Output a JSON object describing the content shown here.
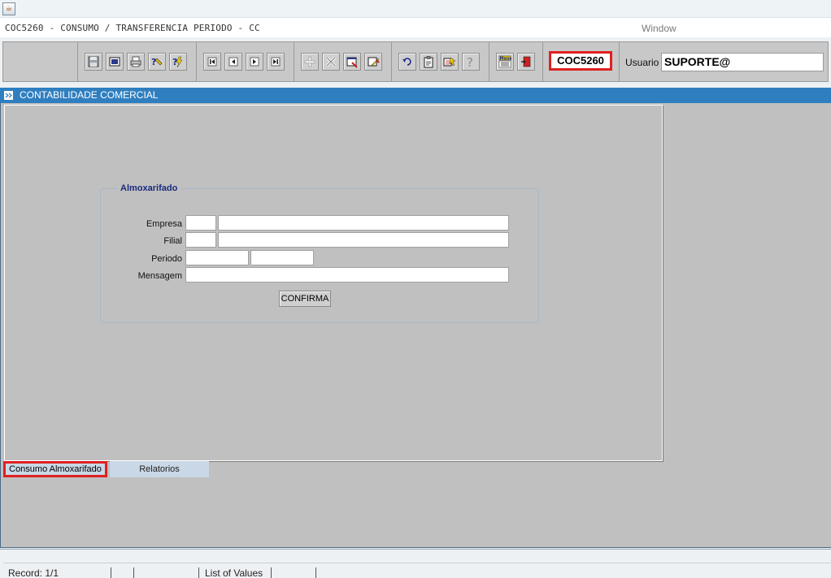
{
  "app": {
    "title": "COC5260 - CONSUMO / TRANSFERENCIA PERIODO - CC",
    "window_menu": "Window"
  },
  "toolbar": {
    "buttons": [
      {
        "icon": "save-icon"
      },
      {
        "icon": "print-preview-icon"
      },
      {
        "icon": "printer-icon"
      },
      {
        "icon": "query-help-icon"
      },
      {
        "icon": "execute-query-icon"
      },
      {
        "icon": "first-record-icon"
      },
      {
        "icon": "previous-record-icon"
      },
      {
        "icon": "next-record-icon"
      },
      {
        "icon": "last-record-icon"
      },
      {
        "icon": "insert-record-icon"
      },
      {
        "icon": "delete-record-icon"
      },
      {
        "icon": "clear-record-icon"
      },
      {
        "icon": "edit-record-icon"
      },
      {
        "icon": "undo-icon"
      },
      {
        "icon": "clipboard-icon"
      },
      {
        "icon": "list-of-values-icon"
      },
      {
        "icon": "help-icon"
      },
      {
        "icon": "menu-icon",
        "text": "Menu"
      },
      {
        "icon": "exit-door-icon"
      }
    ],
    "form_code": "COC5260",
    "usuario_label": "Usuario",
    "usuario_value": "SUPORTE@"
  },
  "window": {
    "title": "CONTABILIDADE COMERCIAL"
  },
  "form": {
    "frame_title": "Almoxarifado",
    "labels": {
      "empresa": "Empresa",
      "filial": "Filial",
      "periodo": "Periodo",
      "mensagem": "Mensagem"
    },
    "values": {
      "empresa_code": "",
      "empresa_name": "",
      "filial_code": "",
      "filial_name": "",
      "periodo_start": "",
      "periodo_end": "",
      "mensagem": ""
    },
    "confirm_label": "CONFIRMA"
  },
  "tabs": [
    {
      "label": "Consumo Almoxarifado",
      "active": true
    },
    {
      "label": "Relatorios",
      "active": false
    }
  ],
  "status": {
    "record": "Record: 1/1",
    "lov": "List of Values"
  },
  "colors": {
    "accent_red": "#e02020",
    "window_bar": "#2f7fc0",
    "canvas_gray": "#c0c0c0"
  }
}
